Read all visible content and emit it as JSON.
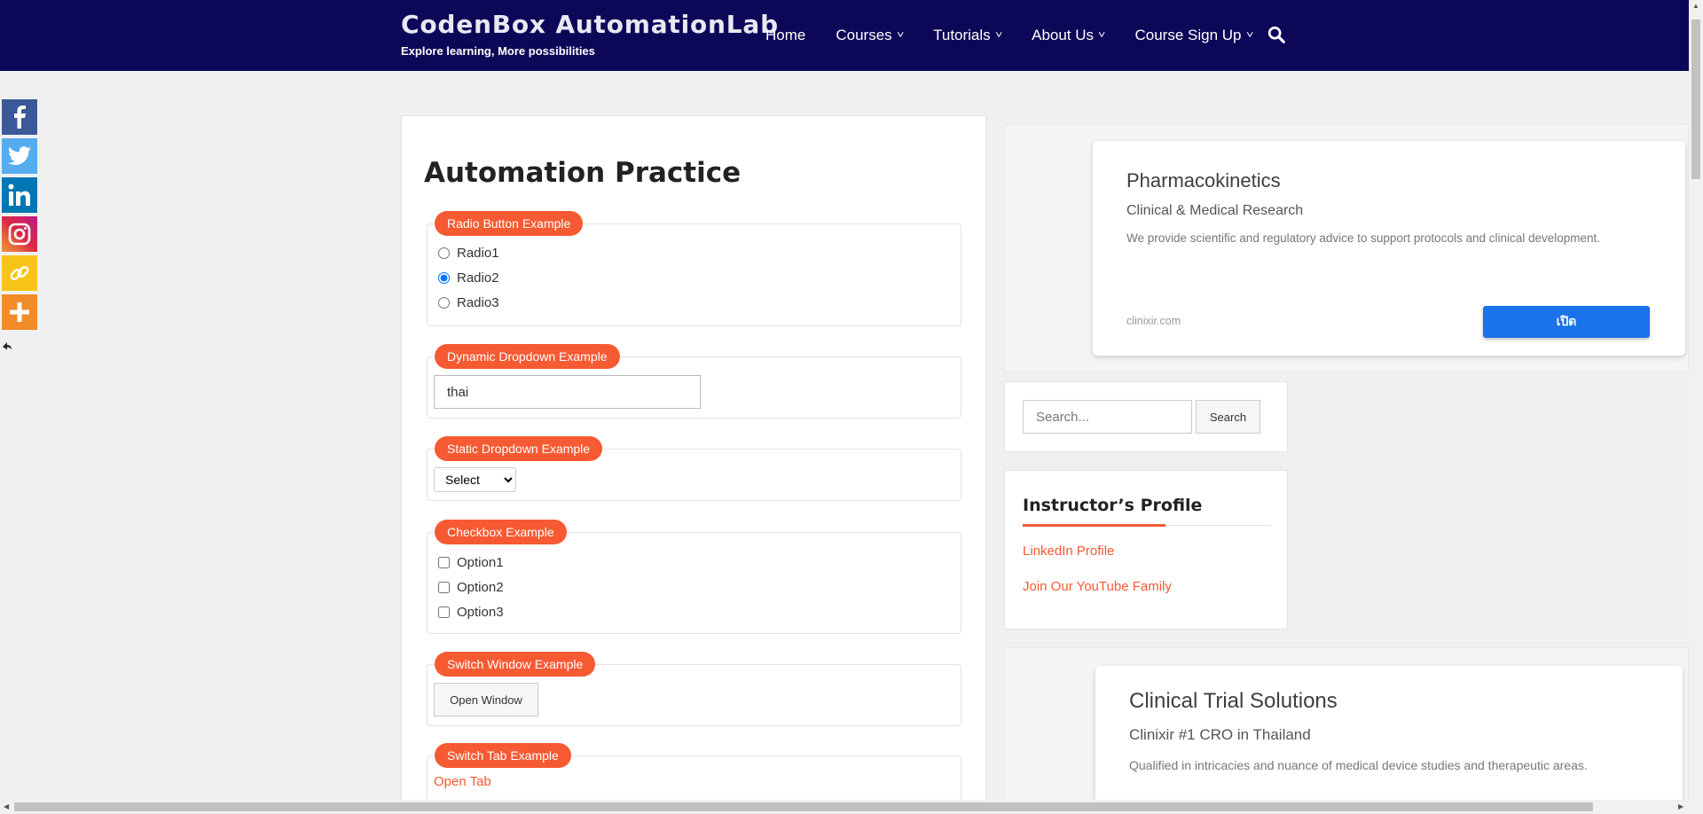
{
  "header": {
    "brand_title": "CodenBox AutomationLab",
    "brand_tagline": "Explore learning, More possibilities",
    "nav": [
      {
        "label": "Home",
        "has_dropdown": false
      },
      {
        "label": "Courses",
        "has_dropdown": true
      },
      {
        "label": "Tutorials",
        "has_dropdown": true
      },
      {
        "label": "About Us",
        "has_dropdown": true
      },
      {
        "label": "Course Sign Up",
        "has_dropdown": true
      }
    ],
    "chevron": "⌄"
  },
  "social": [
    "f",
    "t",
    "in",
    "ig",
    "link",
    "+"
  ],
  "main": {
    "title": "Automation Practice",
    "radio": {
      "legend": "Radio Button Example",
      "options": [
        "Radio1",
        "Radio2",
        "Radio3"
      ],
      "selected": "Radio2"
    },
    "dynamic": {
      "legend": "Dynamic Dropdown Example",
      "value": "thai"
    },
    "static": {
      "legend": "Static Dropdown Example",
      "selected": "Select"
    },
    "checkbox": {
      "legend": "Checkbox Example",
      "options": [
        "Option1",
        "Option2",
        "Option3"
      ]
    },
    "switch_window": {
      "legend": "Switch Window Example",
      "button": "Open Window"
    },
    "switch_tab": {
      "legend": "Switch Tab Example",
      "link": "Open Tab"
    }
  },
  "sidebar": {
    "ad1": {
      "title": "Pharmacokinetics",
      "subtitle": "Clinical & Medical Research",
      "description": "We provide scientific and regulatory advice to support protocols and clinical development.",
      "domain": "clinixir.com",
      "button": "เปิด"
    },
    "search": {
      "placeholder": "Search...",
      "button": "Search"
    },
    "instructor": {
      "title": "Instructor’s Profile",
      "links": [
        "LinkedIn Profile",
        "Join Our YouTube Family"
      ]
    },
    "ad2": {
      "title": "Clinical Trial Solutions",
      "subtitle": "Clinixir #1 CRO in Thailand",
      "description": "Qualified in intricacies and nuance of medical device studies and therapeutic areas."
    }
  },
  "colors": {
    "header_bg": "#0c0757",
    "accent": "#f65a33",
    "ad_button": "#1a73e8"
  }
}
